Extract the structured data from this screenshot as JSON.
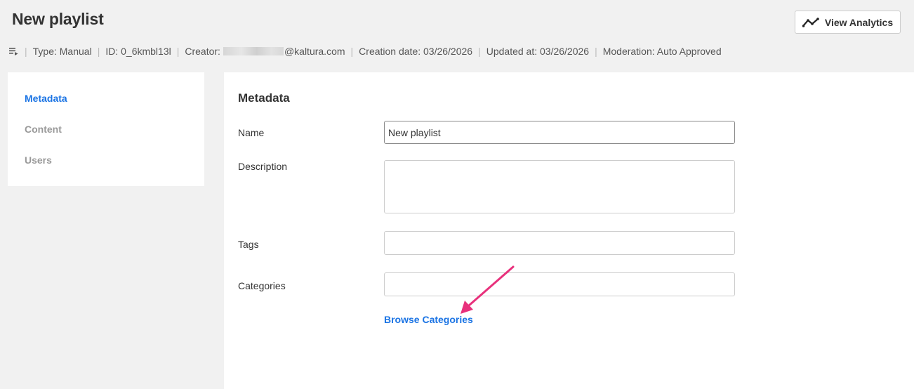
{
  "header": {
    "title": "New playlist",
    "analytics_button_label": "View Analytics",
    "analytics_icon": "line-chart-icon"
  },
  "meta": {
    "playlist_icon": "playlist-icon",
    "type": "Type: Manual",
    "id": "ID: 0_6kmbl13l",
    "creator_prefix": "Creator:",
    "creator_suffix": "@kaltura.com",
    "creation_date": "Creation date: 03/26/2026",
    "updated_at": "Updated at: 03/26/2026",
    "moderation": "Moderation: Auto Approved"
  },
  "sidebar": {
    "items": [
      {
        "label": "Metadata",
        "active": true
      },
      {
        "label": "Content",
        "active": false
      },
      {
        "label": "Users",
        "active": false
      }
    ]
  },
  "form": {
    "section_title": "Metadata",
    "name_label": "Name",
    "name_value": "New playlist",
    "description_label": "Description",
    "description_value": "",
    "tags_label": "Tags",
    "tags_value": "",
    "categories_label": "Categories",
    "categories_value": "",
    "browse_categories_label": "Browse Categories"
  },
  "colors": {
    "accent": "#1b74e4",
    "annotation_arrow": "#e8317c",
    "background": "#f1f1f1"
  }
}
